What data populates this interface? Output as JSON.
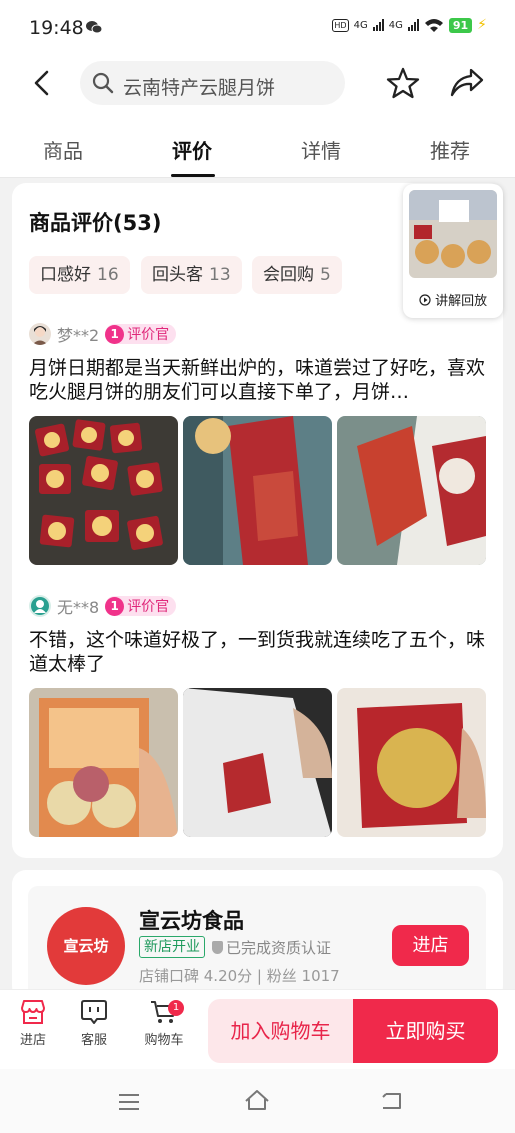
{
  "status_bar": {
    "time": "19:48",
    "battery": "91",
    "network": "4G"
  },
  "header": {
    "search_text": "云南特产云腿月饼"
  },
  "tabs": [
    {
      "label": "商品"
    },
    {
      "label": "评价"
    },
    {
      "label": "详情"
    },
    {
      "label": "推荐"
    }
  ],
  "reviews_section": {
    "title": "商品评价(53)",
    "tags": [
      {
        "label": "口感好",
        "count": "16"
      },
      {
        "label": "回头客",
        "count": "13"
      },
      {
        "label": "会回购",
        "count": "5"
      }
    ],
    "reviews": [
      {
        "user": "梦**2",
        "badge_level": "1",
        "badge_text": "评价官",
        "text": "月饼日期都是当天新鲜出炉的，味道尝过了好吃，喜欢吃火腿月饼的朋友们可以直接下单了，月饼…"
      },
      {
        "user": "无**8",
        "badge_level": "1",
        "badge_text": "评价官",
        "text": "不错，这个味道好极了，一到货我就连续吃了五个，味道太棒了"
      }
    ]
  },
  "live_replay": {
    "label": "讲解回放"
  },
  "store": {
    "logo_text": "宣云坊",
    "name": "宣云坊食品",
    "new_badge": "新店开业",
    "cert": "已完成资质认证",
    "meta": "店铺口碑 4.20分 | 粉丝 1017",
    "enter_label": "进店"
  },
  "bottom_bar": {
    "store_label": "进店",
    "service_label": "客服",
    "cart_label": "购物车",
    "cart_count": "1",
    "add_cart": "加入购物车",
    "buy_now": "立即购买"
  },
  "colors": {
    "accent": "#f0294b",
    "badge_pink": "#f0328a",
    "tag_bg": "#fbf0ef"
  }
}
